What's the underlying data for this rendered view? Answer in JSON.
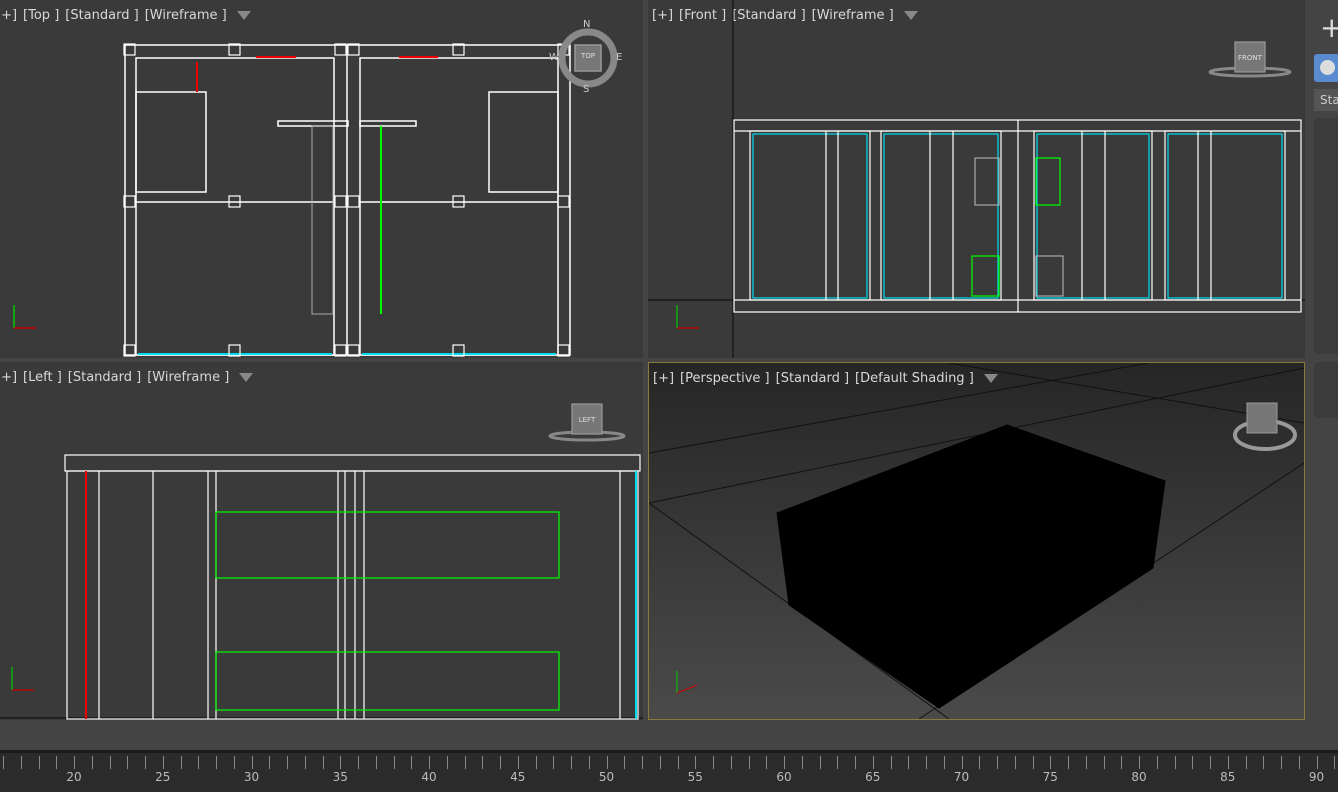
{
  "viewports": [
    {
      "id": "top",
      "labels": [
        "[+]",
        "[Top ]",
        "[Standard ]",
        "[Wireframe ]"
      ],
      "cube": "TOP",
      "compass": [
        "N",
        "E",
        "S",
        "W"
      ]
    },
    {
      "id": "front",
      "labels": [
        "[+]",
        "[Front ]",
        "[Standard ]",
        "[Wireframe ]"
      ],
      "cube": "FRONT"
    },
    {
      "id": "left",
      "labels": [
        "[+]",
        "[Left ]",
        "[Standard ]",
        "[Wireframe ]"
      ],
      "cube": "LEFT"
    },
    {
      "id": "perspective",
      "labels": [
        "[+]",
        "[Perspective ]",
        "[Standard ]",
        "[Default Shading ]"
      ],
      "active": true
    }
  ],
  "panel": {
    "create_icon": "plus-icon",
    "dropdown": "Sta"
  },
  "timeline": {
    "ticks": [
      20,
      25,
      30,
      35,
      40,
      45,
      50,
      55,
      60,
      65,
      70,
      75,
      80,
      85,
      90
    ]
  },
  "colors": {
    "active_border": "#8a7a3a",
    "wire": "#ffffff",
    "green": "#00e000",
    "cyan": "#00d8e8",
    "red": "#e00000"
  }
}
